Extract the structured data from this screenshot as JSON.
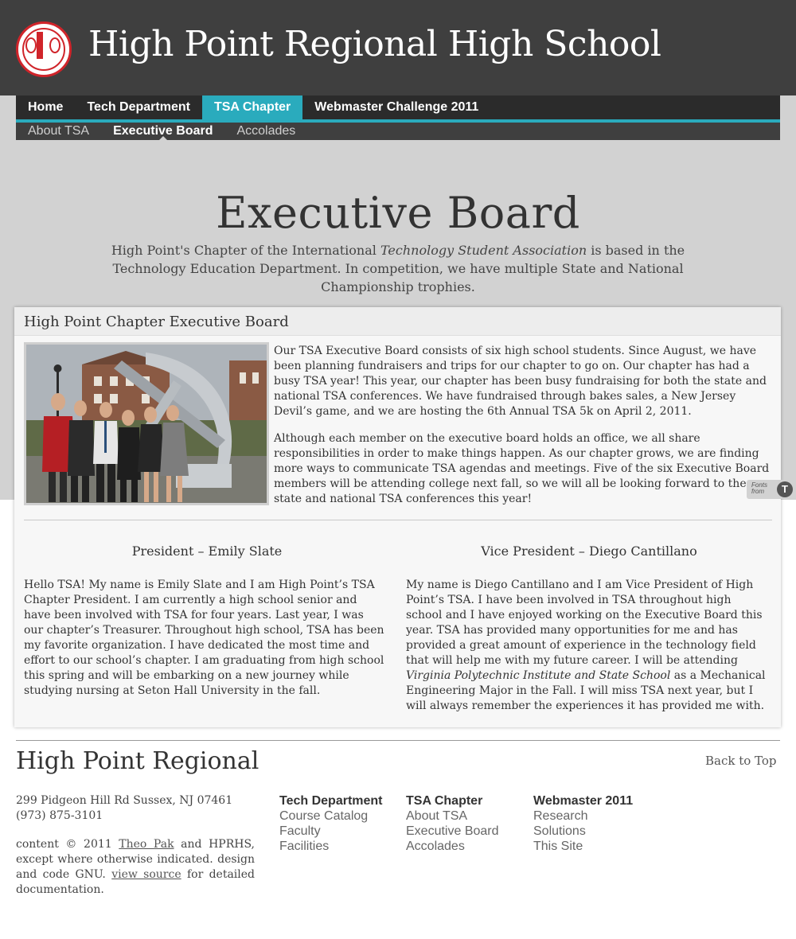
{
  "header": {
    "site_title": "High Point Regional High School"
  },
  "nav": {
    "main": [
      "Home",
      "Tech Department",
      "TSA Chapter",
      "Webmaster Challenge 2011"
    ],
    "sub": [
      "About TSA",
      "Executive Board",
      "Accolades"
    ]
  },
  "page": {
    "title": "Executive Board",
    "intro_before": "High Point's Chapter of the International ",
    "intro_em": "Technology Student Association",
    "intro_after": " is based in the Technology Education Department. In competition, we have multiple State and National Championship trophies."
  },
  "card": {
    "heading": "High Point Chapter Executive Board",
    "paragraph1": "Our TSA Executive Board consists of six high school students. Since August, we have been planning fundraisers and trips for our chapter to go on. Our chapter has had a busy TSA year! This year, our chapter has been busy fundraising for both the state and national TSA conferences. We have fundraised through bakes sales, a New Jersey Devil’s game, and we are hosting the 6th Annual TSA 5k on April 2, 2011.",
    "paragraph2": "Although each member on the executive board holds an office, we all share responsibilities in order to make things happen. As our chapter grows, we are finding more ways to communicate TSA agendas and meetings. Five of the six Executive Board members will be attending college next fall, so we will all be looking forward to the state and national TSA conferences this year!",
    "president_title": "President – Emily Slate",
    "president_text": "Hello TSA! My name is Emily Slate and I am High Point’s TSA Chapter President. I am currently a high school senior and have been involved with TSA for four years. Last year, I was our chapter’s Treasurer. Throughout high school, TSA has been my favorite organization. I have dedicated the most time and effort to our school’s chapter. I am graduating from high school this spring and will be embarking on a new journey while studying nursing at Seton Hall University in the fall.",
    "vp_title": "Vice President – Diego Cantillano",
    "vp_text_before": "My name is Diego Cantillano and I am Vice President of High Point’s TSA. I have been involved in TSA throughout high school and I have enjoyed working on the Executive Board this year. TSA has provided many opportunities for me and has provided a great amount of experience in the technology field that will help me with my future career. I will be attending ",
    "vp_text_em": "Virginia Polytechnic Institute and State School",
    "vp_text_after": " as a Mechanical Engineering Major in the Fall. I will miss TSA next year, but I will always remember the experiences it has provided me with."
  },
  "badge": {
    "line1": "Fonts",
    "line2": "from",
    "logo": "T"
  },
  "footer": {
    "title": "High Point Regional",
    "back_to_top": "Back to Top",
    "address": "299 Pidgeon Hill Rd Sussex, NJ 07461",
    "phone": "(973) 875-3101",
    "copy_1": "content © 2011 ",
    "copy_link1": "Theo Pak",
    "copy_2": " and HPRHS, except where otherwise indicated. design and code GNU. ",
    "copy_link2": "view source",
    "copy_3": " for detailed documentation.",
    "columns": [
      {
        "heading": "Tech Department",
        "links": [
          "Course Catalog",
          "Faculty",
          "Facilities"
        ]
      },
      {
        "heading": "TSA Chapter",
        "links": [
          "About TSA",
          "Executive Board",
          "Accolades"
        ]
      },
      {
        "heading": "Webmaster 2011",
        "links": [
          "Research",
          "Solutions",
          "This Site"
        ]
      }
    ]
  },
  "colors": {
    "header_bg": "#3f3f3f",
    "accent": "#2aabbd",
    "seal_red": "#d0242a"
  }
}
